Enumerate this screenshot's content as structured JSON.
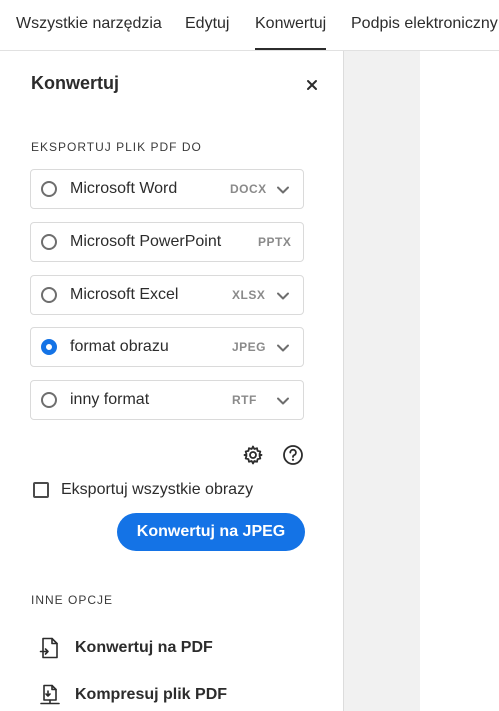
{
  "tabs": [
    {
      "label": "Wszystkie narzędzia"
    },
    {
      "label": "Edytuj"
    },
    {
      "label": "Konwertuj"
    },
    {
      "label": "Podpis elektroniczny"
    }
  ],
  "panel": {
    "title": "Konwertuj",
    "export_section_label": "EKSPORTUJ PLIK PDF DO",
    "options": [
      {
        "label": "Microsoft Word",
        "ext": "DOCX",
        "selected": false,
        "has_dropdown": true
      },
      {
        "label": "Microsoft PowerPoint",
        "ext": "PPTX",
        "selected": false,
        "has_dropdown": false
      },
      {
        "label": "Microsoft Excel",
        "ext": "XLSX",
        "selected": false,
        "has_dropdown": true
      },
      {
        "label": "format obrazu",
        "ext": "JPEG",
        "selected": true,
        "has_dropdown": true
      },
      {
        "label": "inny format",
        "ext": "RTF",
        "selected": false,
        "has_dropdown": true
      }
    ],
    "export_all_images_label": "Eksportuj wszystkie obrazy",
    "export_all_images_checked": false,
    "convert_button_label": "Konwertuj na JPEG",
    "other_section_label": "INNE OPCJE",
    "other_options": [
      {
        "label": "Konwertuj na PDF",
        "icon": "convert-to-pdf-icon"
      },
      {
        "label": "Kompresuj plik PDF",
        "icon": "compress-pdf-icon"
      }
    ]
  },
  "colors": {
    "accent": "#1473e6"
  }
}
